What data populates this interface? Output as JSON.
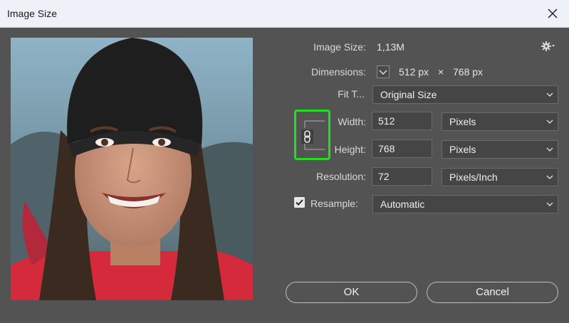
{
  "window": {
    "title": "Image Size"
  },
  "info": {
    "image_size_label": "Image Size:",
    "image_size_value": "1,13M",
    "dimensions_label": "Dimensions:",
    "dimensions_width": "512 px",
    "dimensions_times": "×",
    "dimensions_height": "768 px"
  },
  "fit_to": {
    "label": "Fit T...",
    "value": "Original Size"
  },
  "width": {
    "label": "Width:",
    "value": "512",
    "unit": "Pixels"
  },
  "height": {
    "label": "Height:",
    "value": "768",
    "unit": "Pixels"
  },
  "resolution": {
    "label": "Resolution:",
    "value": "72",
    "unit": "Pixels/Inch"
  },
  "resample": {
    "label": "Resample:",
    "checked": true,
    "value": "Automatic"
  },
  "buttons": {
    "ok": "OK",
    "cancel": "Cancel"
  },
  "colors": {
    "highlight": "#21e021",
    "dialog_bg": "#535353",
    "titlebar_bg": "#eef2f8"
  },
  "icons": {
    "settings": "gear-icon",
    "link": "chain-link-icon",
    "close": "close-icon"
  }
}
